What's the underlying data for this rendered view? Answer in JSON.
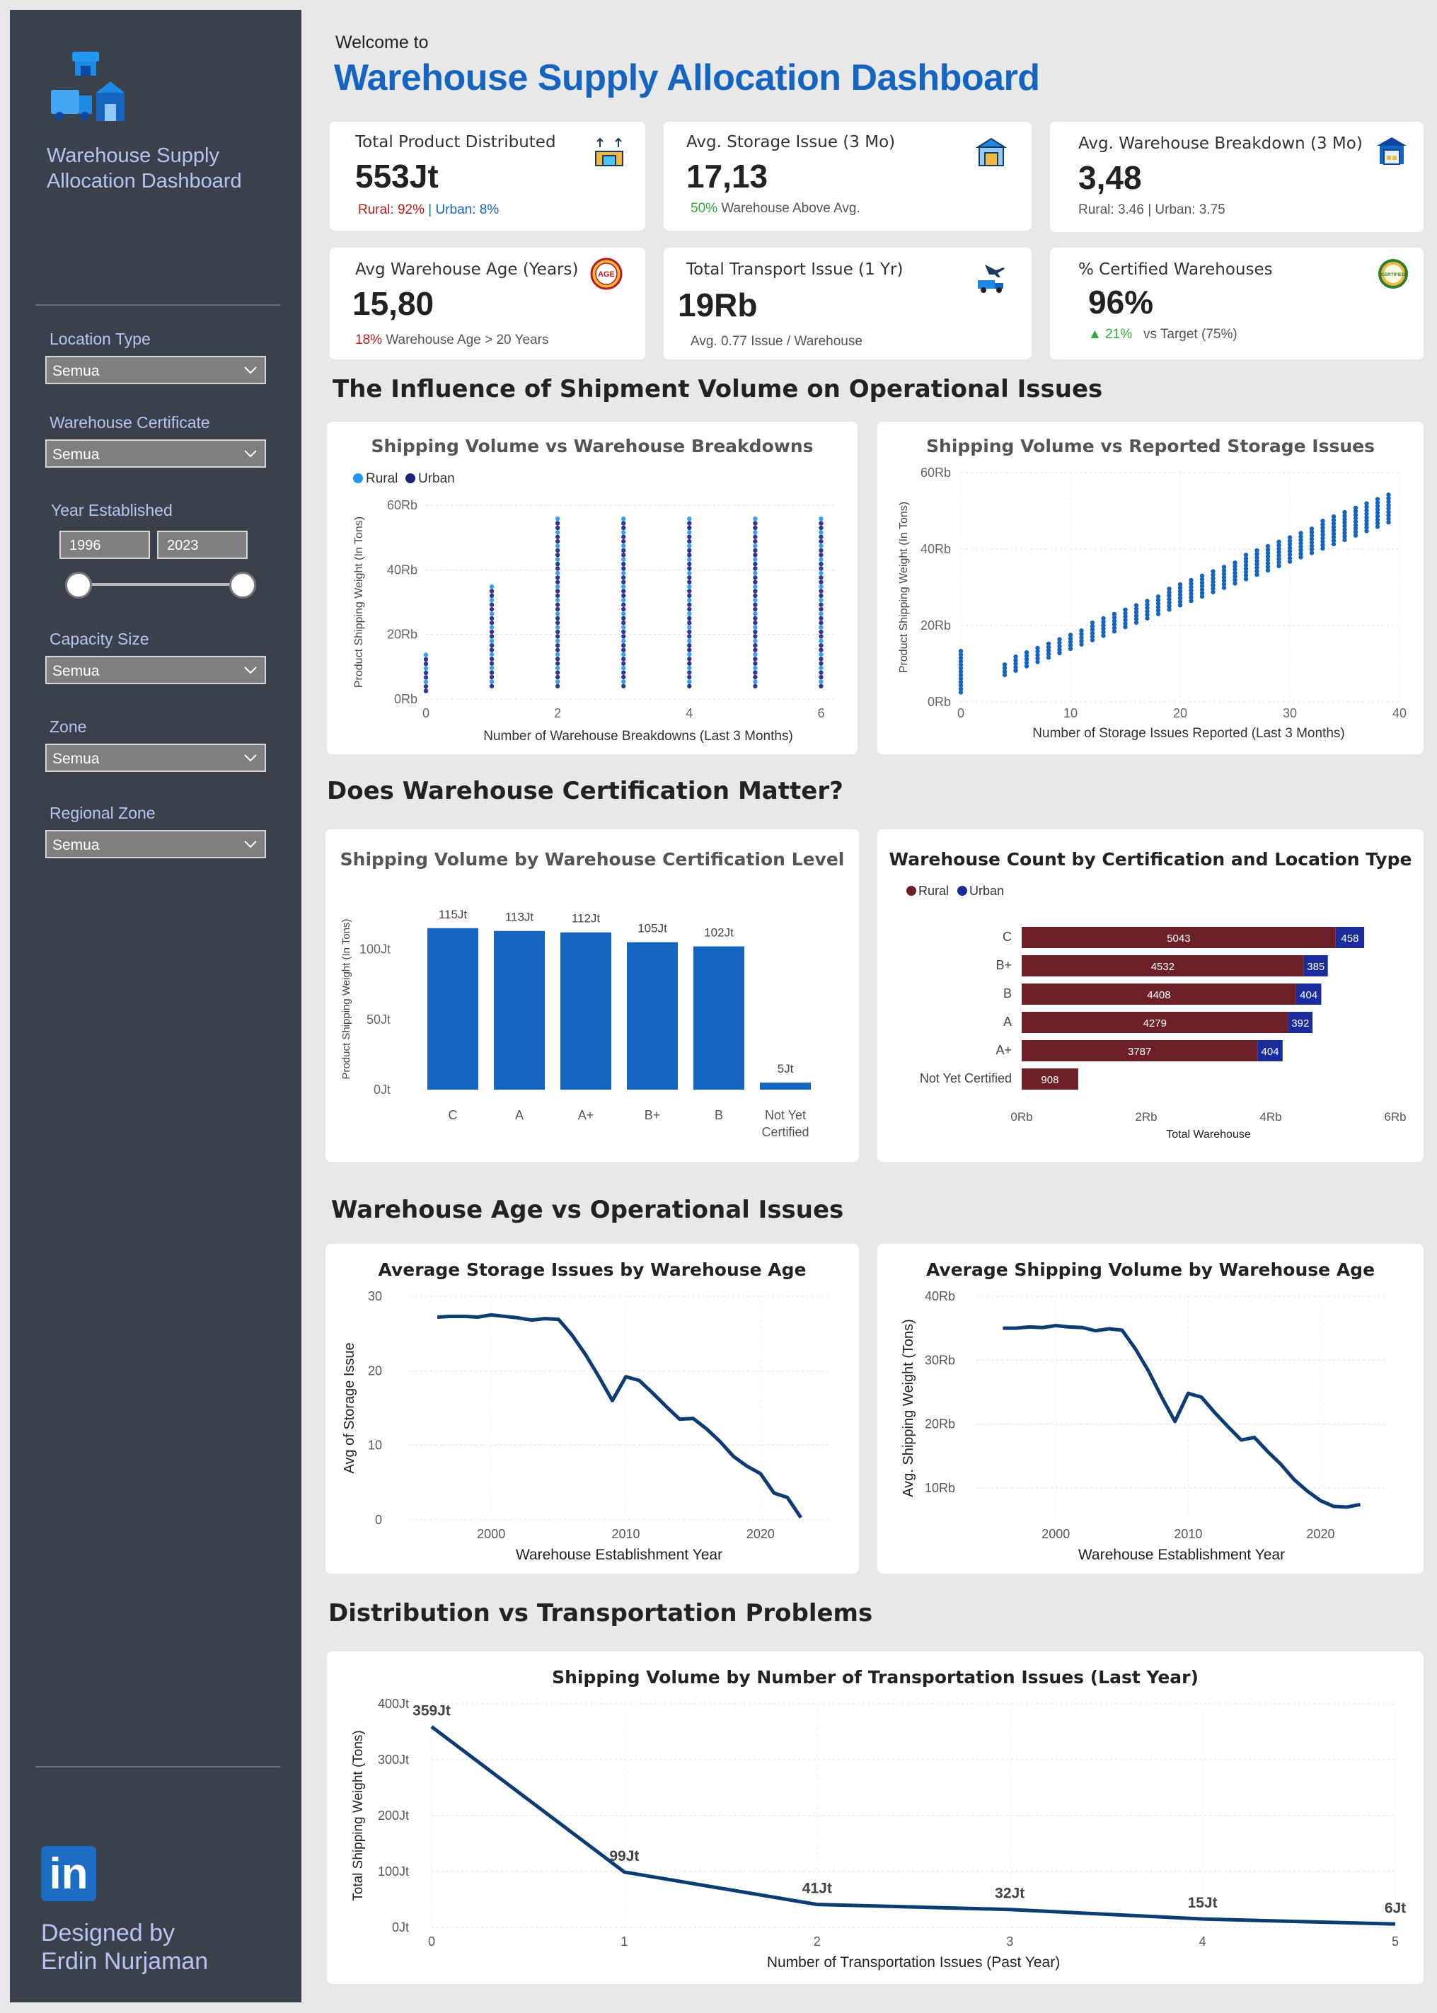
{
  "sidebar": {
    "title": "Warehouse Supply Allocation Dashboard",
    "filters": [
      {
        "label": "Location Type",
        "value": "Semua"
      },
      {
        "label": "Warehouse Certificate",
        "value": "Semua"
      },
      {
        "label": "Capacity Size",
        "value": "Semua"
      },
      {
        "label": "Zone",
        "value": "Semua"
      },
      {
        "label": "Regional Zone",
        "value": "Semua"
      }
    ],
    "year": {
      "label": "Year Established",
      "from": "1996",
      "to": "2023"
    },
    "linkedin": "in",
    "designed_by": "Designed by",
    "author": "Erdin Nurjaman"
  },
  "header": {
    "welcome": "Welcome to",
    "title": "Warehouse Supply Allocation Dashboard"
  },
  "kpis": {
    "total_product": {
      "label": "Total Product Distributed",
      "value": "553Jt",
      "rural": "Rural: 92%",
      "sep": "|",
      "urban": "Urban: 8%"
    },
    "storage_issue": {
      "label": "Avg. Storage Issue (3 Mo)",
      "value": "17,13",
      "pct": "50%",
      "note": "Warehouse Above Avg."
    },
    "breakdown": {
      "label": "Avg. Warehouse Breakdown (3 Mo)",
      "value": "3,48",
      "note": "Rural: 3.46 | Urban: 3.75"
    },
    "age": {
      "label": "Avg Warehouse Age (Years)",
      "value": "15,80",
      "pct": "18%",
      "note": "Warehouse Age > 20 Years",
      "icon_text": "AGE"
    },
    "transport": {
      "label": "Total Transport Issue (1 Yr)",
      "value": "19Rb",
      "note": "Avg. 0.77 Issue / Warehouse"
    },
    "certified": {
      "label": "% Certified Warehouses",
      "value": "96%",
      "delta": "▲ 21%",
      "note": "vs Target (75%)",
      "icon_text": "CERTIFIED"
    }
  },
  "sections": {
    "s1": "The Influence of Shipment Volume on Operational Issues",
    "s2": "Does Warehouse Certification Matter?",
    "s3": "Warehouse Age vs Operational Issues",
    "s4": "Distribution vs Transportation Problems"
  },
  "colors": {
    "rural_light": "#2196f3",
    "urban_dark": "#1a237e",
    "bar_blue": "#1565c0",
    "rural_maroon": "#6d2028",
    "urban_navy": "#1a2b9c",
    "line_navy": "#0d3c73"
  },
  "chart_data": [
    {
      "type": "scatter",
      "title": "Shipping Volume vs Warehouse Breakdowns",
      "xlabel": "Number of Warehouse Breakdowns (Last 3 Months)",
      "ylabel": "Product Shipping Weight (In Tons)",
      "legend": [
        "Rural",
        "Urban"
      ],
      "legend_position": "top-left",
      "xlim": [
        0,
        6.5
      ],
      "ylim": [
        0,
        60000
      ],
      "xticks": [
        0,
        2,
        4,
        6
      ],
      "yticks": [
        {
          "v": 0,
          "label": "0Rb"
        },
        {
          "v": 20000,
          "label": "20Rb"
        },
        {
          "v": 40000,
          "label": "40Rb"
        },
        {
          "v": 60000,
          "label": "60Rb"
        }
      ],
      "columns": [
        {
          "x": 0,
          "min": 2500,
          "max": 15000
        },
        {
          "x": 1,
          "min": 4000,
          "max": 35000
        },
        {
          "x": 2,
          "min": 4000,
          "max": 56000
        },
        {
          "x": 3,
          "min": 4000,
          "max": 56000
        },
        {
          "x": 4,
          "min": 4000,
          "max": 56000
        },
        {
          "x": 5,
          "min": 4000,
          "max": 56000
        },
        {
          "x": 6,
          "min": 4000,
          "max": 56000
        }
      ]
    },
    {
      "type": "scatter",
      "title": "Shipping Volume vs Reported Storage Issues",
      "xlabel": "Number of Storage Issues Reported (Last 3 Months)",
      "ylabel": "Product Shipping Weight (In Tons)",
      "xlim": [
        0,
        40
      ],
      "ylim": [
        0,
        60000
      ],
      "xticks": [
        0,
        10,
        20,
        30,
        40
      ],
      "yticks": [
        {
          "v": 0,
          "label": "0Rb"
        },
        {
          "v": 20000,
          "label": "20Rb"
        },
        {
          "v": 40000,
          "label": "40Rb"
        },
        {
          "v": 60000,
          "label": "60Rb"
        }
      ],
      "trend": {
        "x_from": 0,
        "x_to": 39,
        "y_min_start": 2500,
        "y_max_start": 14000,
        "y_min_end": 47000,
        "y_max_end": 55000
      }
    },
    {
      "type": "bar",
      "title": "Shipping Volume by Warehouse Certification Level",
      "ylabel": "Product Shipping Weight (In Tons)",
      "categories": [
        "C",
        "A",
        "A+",
        "B+",
        "B",
        "Not Yet Certified"
      ],
      "values": [
        115,
        113,
        112,
        105,
        102,
        5
      ],
      "labels": [
        "115Jt",
        "113Jt",
        "112Jt",
        "105Jt",
        "102Jt",
        "5Jt"
      ],
      "ylim": [
        0,
        130
      ],
      "yticks": [
        {
          "v": 0,
          "label": "0Jt"
        },
        {
          "v": 50,
          "label": "50Jt"
        },
        {
          "v": 100,
          "label": "100Jt"
        }
      ]
    },
    {
      "type": "bar",
      "orientation": "horizontal-stacked",
      "title": "Warehouse Count by Certification and Location Type",
      "xlabel": "Total Warehouse",
      "legend": [
        "Rural",
        "Urban"
      ],
      "legend_position": "top-left",
      "categories": [
        "C",
        "B+",
        "B",
        "A",
        "A+",
        "Not Yet Certified"
      ],
      "series": [
        {
          "name": "Rural",
          "values": [
            5043,
            4532,
            4408,
            4279,
            3787,
            908
          ]
        },
        {
          "name": "Urban",
          "values": [
            458,
            385,
            404,
            392,
            404,
            0
          ]
        }
      ],
      "xlim": [
        0,
        6000
      ],
      "xticks": [
        {
          "v": 0,
          "label": "0Rb"
        },
        {
          "v": 2000,
          "label": "2Rb"
        },
        {
          "v": 4000,
          "label": "4Rb"
        },
        {
          "v": 6000,
          "label": "6Rb"
        }
      ]
    },
    {
      "type": "line",
      "title": "Average Storage Issues by Warehouse Age",
      "xlabel": "Warehouse Establishment Year",
      "ylabel": "Avg of Storage Issue",
      "xlim": [
        1994,
        2025
      ],
      "ylim": [
        0,
        30
      ],
      "xticks": [
        2000,
        2010,
        2020
      ],
      "yticks": [
        {
          "v": 0,
          "label": "0"
        },
        {
          "v": 10,
          "label": "10"
        },
        {
          "v": 20,
          "label": "20"
        },
        {
          "v": 30,
          "label": "30"
        }
      ],
      "x": [
        1996,
        1997,
        1998,
        1999,
        2000,
        2001,
        2002,
        2003,
        2004,
        2005,
        2006,
        2007,
        2008,
        2009,
        2010,
        2011,
        2012,
        2013,
        2014,
        2015,
        2016,
        2017,
        2018,
        2019,
        2020,
        2021,
        2022,
        2023
      ],
      "y": [
        27.2,
        27.3,
        27.3,
        27.2,
        27.5,
        27.3,
        27.1,
        26.8,
        27.0,
        26.9,
        24.8,
        22.2,
        19.2,
        16.0,
        19.2,
        18.7,
        17.0,
        15.2,
        13.5,
        13.6,
        12.2,
        10.5,
        8.5,
        7.2,
        6.2,
        3.6,
        3.0,
        0.3
      ]
    },
    {
      "type": "line",
      "title": "Average Shipping Volume by Warehouse Age",
      "xlabel": "Warehouse Establishment Year",
      "ylabel": "Avg. Shipping Weight (Tons)",
      "xlim": [
        1994,
        2025
      ],
      "ylim": [
        5000,
        40000
      ],
      "xticks": [
        2000,
        2010,
        2020
      ],
      "yticks": [
        {
          "v": 10000,
          "label": "10Rb"
        },
        {
          "v": 20000,
          "label": "20Rb"
        },
        {
          "v": 30000,
          "label": "30Rb"
        },
        {
          "v": 40000,
          "label": "40Rb"
        }
      ],
      "x": [
        1996,
        1997,
        1998,
        1999,
        2000,
        2001,
        2002,
        2003,
        2004,
        2005,
        2006,
        2007,
        2008,
        2009,
        2010,
        2011,
        2012,
        2013,
        2014,
        2015,
        2016,
        2017,
        2018,
        2019,
        2020,
        2021,
        2022,
        2023
      ],
      "y": [
        35000,
        35000,
        35200,
        35100,
        35400,
        35200,
        35100,
        34600,
        34900,
        34700,
        31800,
        28300,
        24200,
        20400,
        24800,
        24200,
        21800,
        19600,
        17500,
        17900,
        15700,
        13700,
        11300,
        9500,
        8000,
        7100,
        7000,
        7400
      ]
    },
    {
      "type": "line",
      "title": "Shipping Volume by Number of Transportation Issues (Last Year)",
      "xlabel": "Number of Transportation Issues (Past Year)",
      "ylabel": "Total Shipping Weight (Tons)",
      "xlim": [
        0,
        5
      ],
      "ylim": [
        0,
        400
      ],
      "x": [
        0,
        1,
        2,
        3,
        4,
        5
      ],
      "y": [
        359,
        99,
        41,
        32,
        15,
        6
      ],
      "labels": [
        "359Jt",
        "99Jt",
        "41Jt",
        "32Jt",
        "15Jt",
        "6Jt"
      ],
      "yticks": [
        {
          "v": 0,
          "label": "0Jt"
        },
        {
          "v": 100,
          "label": "100Jt"
        },
        {
          "v": 200,
          "label": "200Jt"
        },
        {
          "v": 300,
          "label": "300Jt"
        },
        {
          "v": 400,
          "label": "400Jt"
        }
      ]
    }
  ]
}
